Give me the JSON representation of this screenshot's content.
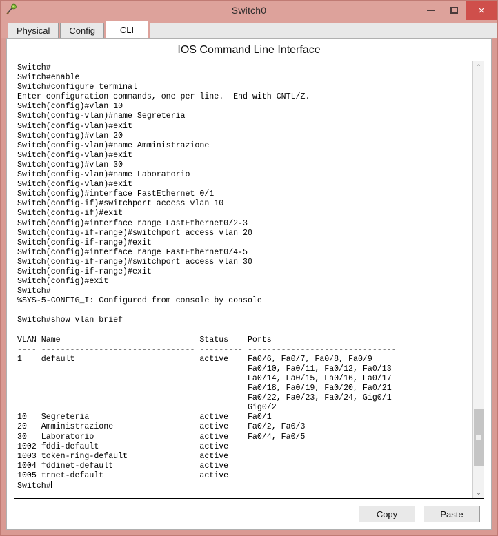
{
  "window": {
    "title": "Switch0",
    "icon": "packet-tracer-device-icon",
    "controls": {
      "minimize": "minimize-icon",
      "maximize": "maximize-icon",
      "close": "×"
    }
  },
  "tabs": [
    {
      "label": "Physical",
      "active": false
    },
    {
      "label": "Config",
      "active": false
    },
    {
      "label": "CLI",
      "active": true
    }
  ],
  "panel": {
    "heading": "IOS Command Line Interface"
  },
  "terminal": {
    "lines": [
      "Switch#",
      "Switch#enable",
      "Switch#configure terminal",
      "Enter configuration commands, one per line.  End with CNTL/Z.",
      "Switch(config)#vlan 10",
      "Switch(config-vlan)#name Segreteria",
      "Switch(config-vlan)#exit",
      "Switch(config)#vlan 20",
      "Switch(config-vlan)#name Amministrazione",
      "Switch(config-vlan)#exit",
      "Switch(config)#vlan 30",
      "Switch(config-vlan)#name Laboratorio",
      "Switch(config-vlan)#exit",
      "Switch(config)#interface FastEthernet 0/1",
      "Switch(config-if)#switchport access vlan 10",
      "Switch(config-if)#exit",
      "Switch(config)#interface range FastEthernet0/2-3",
      "Switch(config-if-range)#switchport access vlan 20",
      "Switch(config-if-range)#exit",
      "Switch(config)#interface range FastEthernet0/4-5",
      "Switch(config-if-range)#switchport access vlan 30",
      "Switch(config-if-range)#exit",
      "Switch(config)#exit",
      "Switch#",
      "%SYS-5-CONFIG_I: Configured from console by console",
      "",
      "Switch#show vlan brief",
      "",
      "VLAN Name                             Status    Ports",
      "---- -------------------------------- --------- -------------------------------",
      "1    default                          active    Fa0/6, Fa0/7, Fa0/8, Fa0/9",
      "                                                Fa0/10, Fa0/11, Fa0/12, Fa0/13",
      "                                                Fa0/14, Fa0/15, Fa0/16, Fa0/17",
      "                                                Fa0/18, Fa0/19, Fa0/20, Fa0/21",
      "                                                Fa0/22, Fa0/23, Fa0/24, Gig0/1",
      "                                                Gig0/2",
      "10   Segreteria                       active    Fa0/1",
      "20   Amministrazione                  active    Fa0/2, Fa0/3",
      "30   Laboratorio                      active    Fa0/4, Fa0/5",
      "1002 fddi-default                     active    ",
      "1003 token-ring-default               active    ",
      "1004 fddinet-default                  active    ",
      "1005 trnet-default                    active    "
    ],
    "prompt": "Switch#"
  },
  "scrollbar": {
    "up_arrow": "⌃",
    "down_arrow": "⌄",
    "thumb_top_pct": 81,
    "thumb_height_pct": 14
  },
  "buttons": {
    "copy": "Copy",
    "paste": "Paste"
  },
  "colors": {
    "title_bar": "#dda29b",
    "close_button": "#cf4f4b",
    "frame": "#d99a93",
    "panel_bg": "#ffffff",
    "terminal_text": "#000000"
  }
}
